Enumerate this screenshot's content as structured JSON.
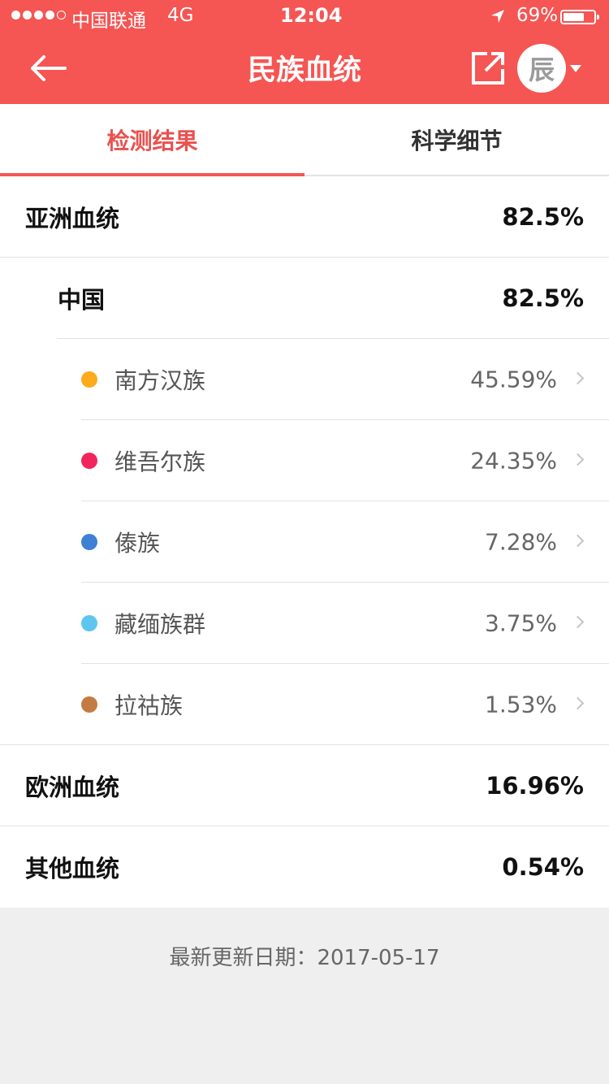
{
  "status_bar": {
    "carrier": "中国联通",
    "network": "4G",
    "time": "12:04",
    "battery_percent": "69%",
    "battery_level": 0.69
  },
  "nav": {
    "title": "民族血统",
    "avatar_text": "辰",
    "icons": [
      "arrow-left-icon",
      "share-external-icon",
      "chevron-down-icon"
    ]
  },
  "tabs": [
    {
      "label": "检测结果",
      "active": true
    },
    {
      "label": "科学细节",
      "active": false
    }
  ],
  "ancestry": {
    "asia": {
      "label": "亚洲血统",
      "value": "82.5%"
    },
    "china": {
      "label": "中国",
      "value": "82.5%"
    },
    "groups": [
      {
        "label": "南方汉族",
        "value": "45.59%",
        "color": "#fbab1b"
      },
      {
        "label": "维吾尔族",
        "value": "24.35%",
        "color": "#f2245e"
      },
      {
        "label": "傣族",
        "value": "7.28%",
        "color": "#3d80d6"
      },
      {
        "label": "藏缅族群",
        "value": "3.75%",
        "color": "#5ec5ee"
      },
      {
        "label": "拉祜族",
        "value": "1.53%",
        "color": "#c47b42"
      }
    ],
    "europe": {
      "label": "欧洲血统",
      "value": "16.96%"
    },
    "other": {
      "label": "其他血统",
      "value": "0.54%"
    }
  },
  "footer": {
    "updated": "最新更新日期：2017-05-17"
  },
  "colors": {
    "brand": "#f55553",
    "active_tab": "#e8524f",
    "background": "#efefef"
  }
}
